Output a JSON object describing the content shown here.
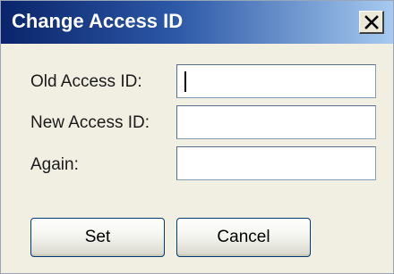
{
  "window": {
    "title": "Change Access ID"
  },
  "form": {
    "old_label": "Old Access ID:",
    "new_label": "New Access ID:",
    "again_label": "Again:",
    "old_value": "",
    "new_value": "",
    "again_value": ""
  },
  "buttons": {
    "set_label": "Set",
    "cancel_label": "Cancel"
  },
  "icons": {
    "close": "close-icon"
  },
  "colors": {
    "titlebar_start": "#0a246a",
    "titlebar_end": "#a6caf0",
    "dialog_background": "#f1efe2"
  }
}
